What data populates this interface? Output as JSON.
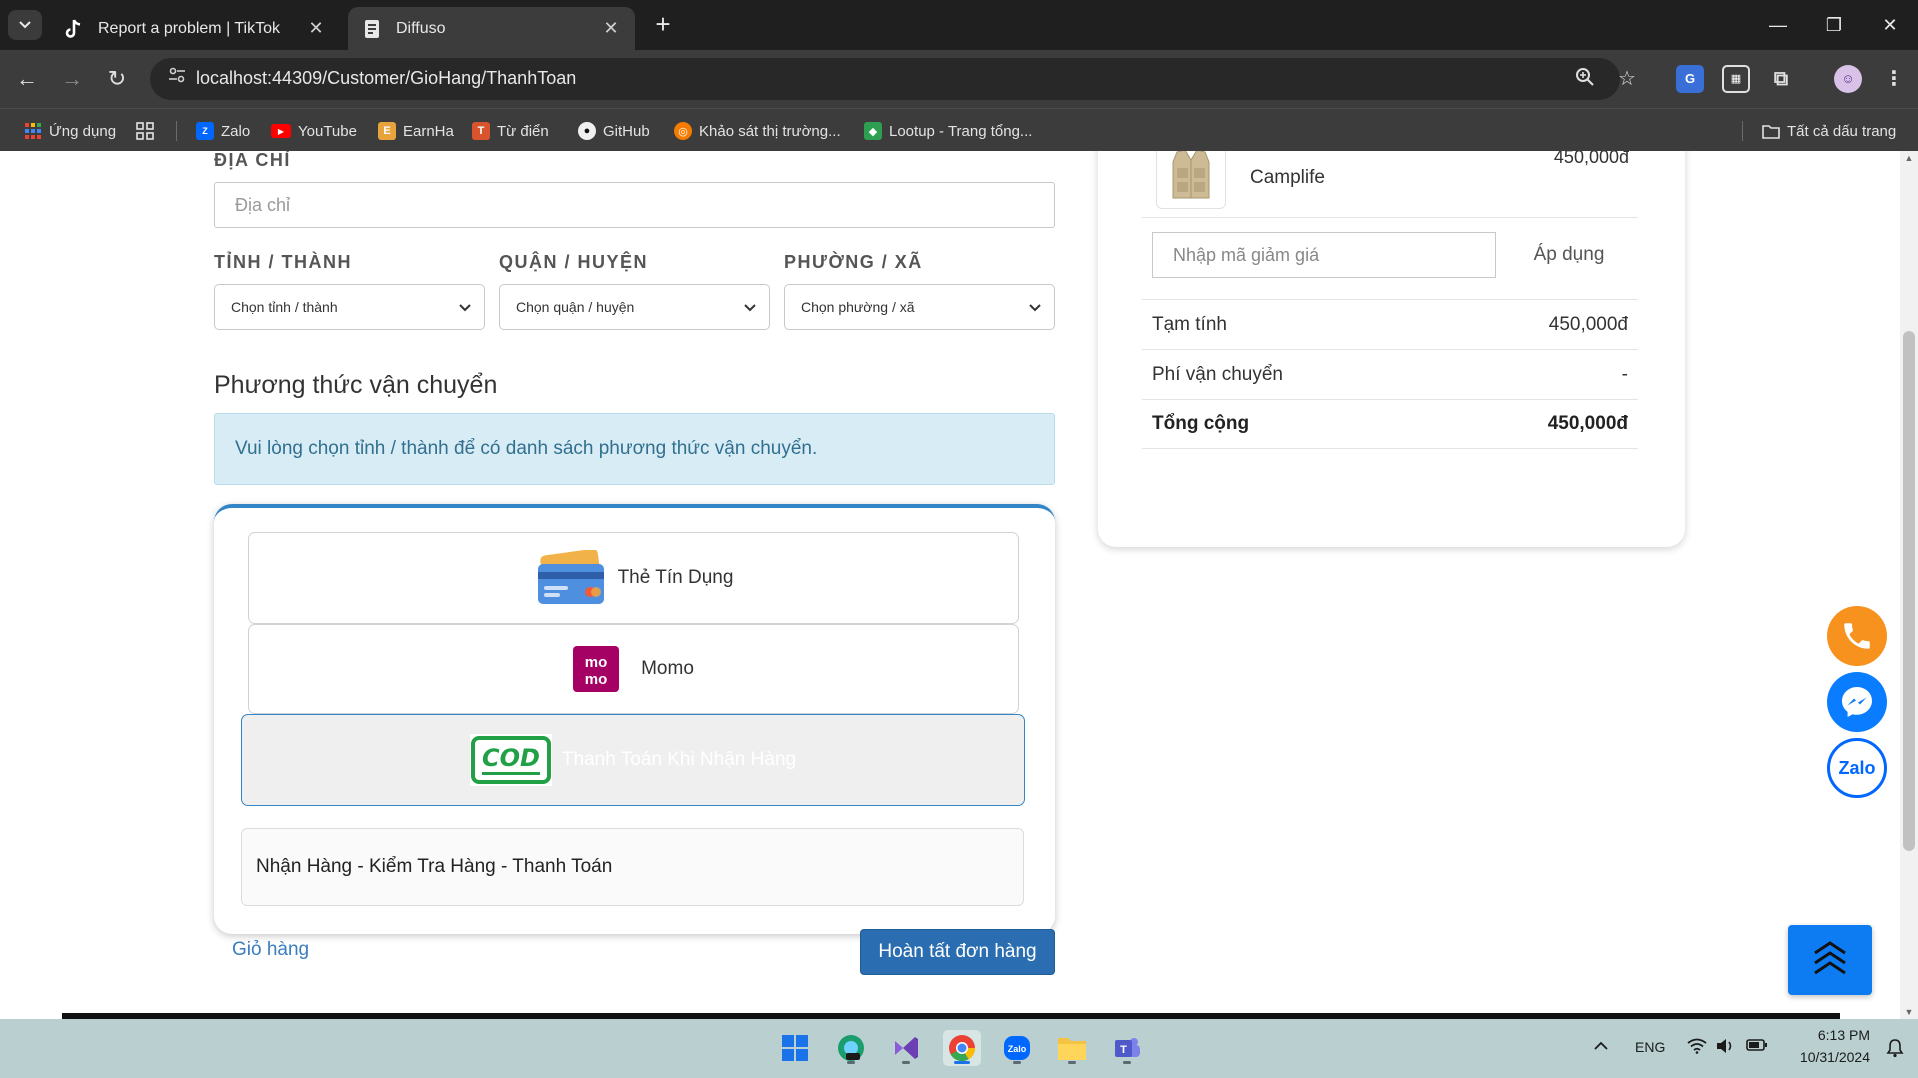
{
  "browser": {
    "tabs": [
      {
        "title": "Report a problem | TikTok",
        "active": false,
        "icon": "tiktok-icon"
      },
      {
        "title": "Diffuso",
        "active": true,
        "icon": "document-icon"
      }
    ],
    "url": "localhost:44309/Customer/GioHang/ThanhToan",
    "bookmarks": [
      {
        "label": "Ứng dụng",
        "icon": "apps-grid-icon"
      },
      {
        "label": "Zalo",
        "icon": "zalo-icon"
      },
      {
        "label": "YouTube",
        "icon": "youtube-icon"
      },
      {
        "label": "EarnHa",
        "icon": "earnha-icon"
      },
      {
        "label": "Từ điển",
        "icon": "dictionary-icon"
      },
      {
        "label": "GitHub",
        "icon": "github-icon"
      },
      {
        "label": "Khảo sát thị trường...",
        "icon": "survey-icon"
      },
      {
        "label": "Lootup - Trang tổng...",
        "icon": "lootup-icon"
      }
    ],
    "all_bookmarks": "Tất cả dấu trang"
  },
  "form": {
    "address_label": "ĐỊA CHỈ",
    "address_placeholder": "Địa chỉ",
    "province_label": "TỈNH / THÀNH",
    "province_value": "Chọn tỉnh / thành",
    "district_label": "QUẬN / HUYỆN",
    "district_value": "Chọn quận / huyện",
    "ward_label": "PHƯỜNG / XÃ",
    "ward_value": "Chọn phường / xã"
  },
  "shipping": {
    "title": "Phương thức vận chuyển",
    "notice": "Vui lòng chọn tỉnh / thành để có danh sách phương thức vận chuyển."
  },
  "payment": {
    "options": [
      {
        "label": "Thẻ Tín Dụng",
        "icon": "credit-card-icon",
        "selected": false
      },
      {
        "label": "Momo",
        "icon": "momo-logo",
        "selected": false
      },
      {
        "label": "Thanh Toán Khi Nhận Hàng",
        "icon": "cod-logo",
        "selected": true
      }
    ],
    "note": "Nhận Hàng - Kiểm Tra Hàng - Thanh Toán"
  },
  "actions": {
    "cart_link": "Giỏ hàng",
    "complete": "Hoàn tất đơn hàng"
  },
  "summary": {
    "product_name": "Camplife",
    "product_price": "450,000đ",
    "discount_placeholder": "Nhập mã giảm giá",
    "apply": "Áp dụng",
    "subtotal_label": "Tạm tính",
    "subtotal_value": "450,000đ",
    "shipping_label": "Phí vận chuyển",
    "shipping_value": "-",
    "total_label": "Tổng cộng",
    "total_value": "450,000đ"
  },
  "taskbar": {
    "lang": "ENG",
    "time": "6:13 PM",
    "date": "10/31/2024"
  },
  "colors": {
    "primary": "#2a6eb1",
    "info_bg": "#d8ecf5",
    "info_text": "#31708f",
    "phone": "#f7921e",
    "messenger": "#0a7cff",
    "zalo": "#0068ff",
    "momo": "#a50064",
    "cod": "#22a046"
  }
}
